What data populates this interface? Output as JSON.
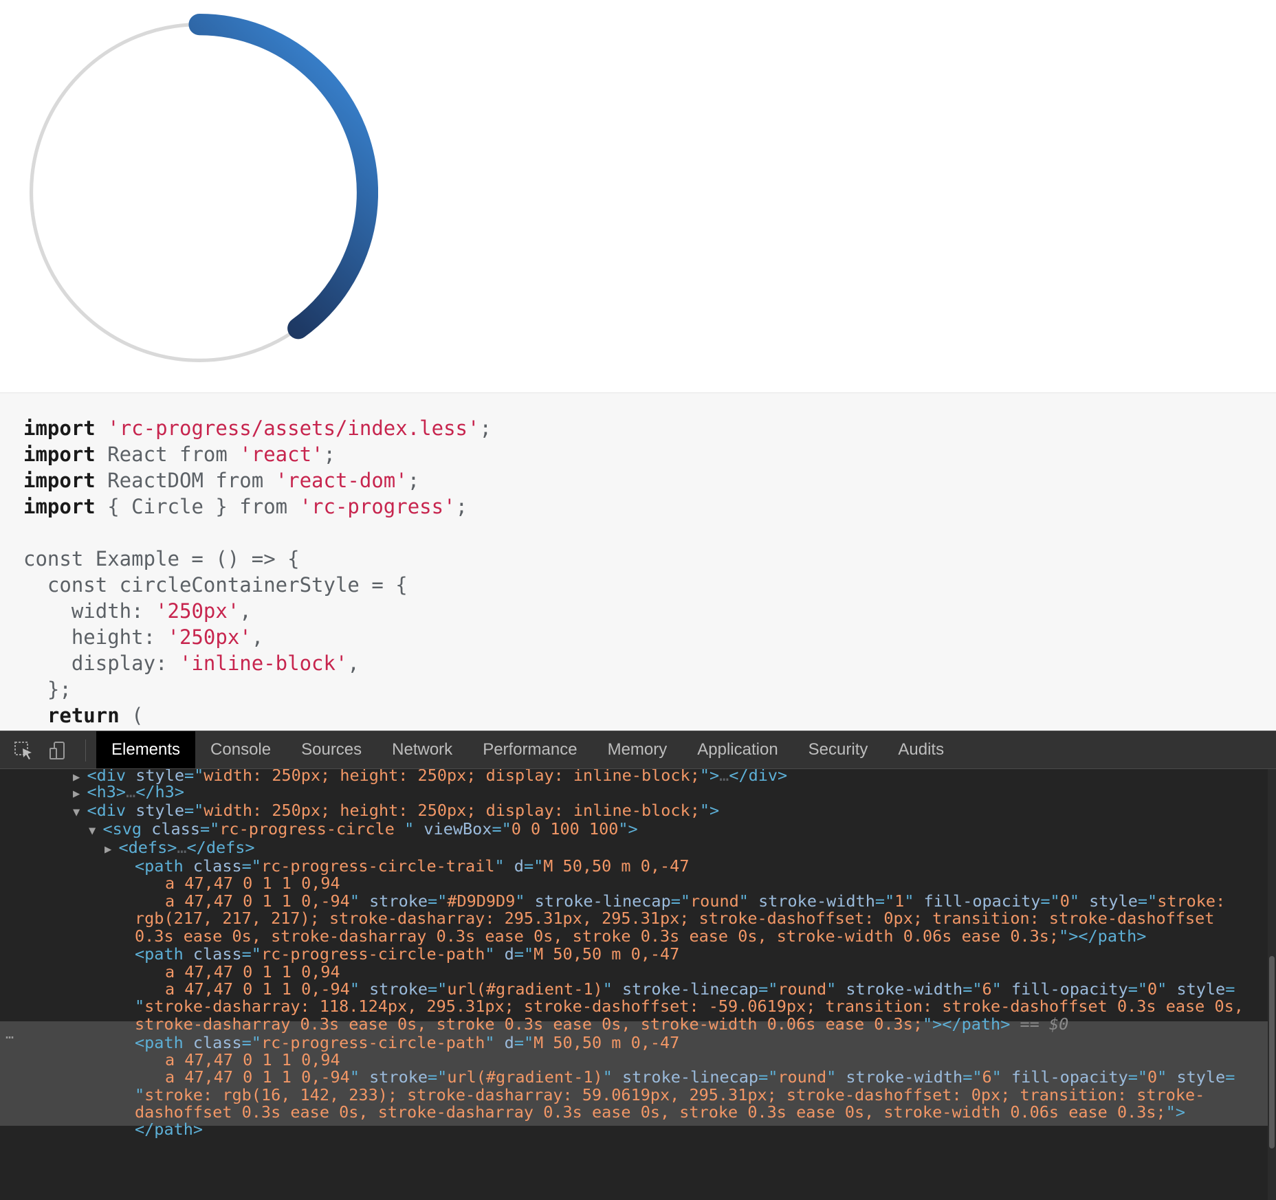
{
  "progress": {
    "percent": 20,
    "offset_percent": 20,
    "stroke_width": 6,
    "trail_width": 1,
    "trail_color": "#D9D9D9",
    "gradient_start": "#1a1a1a",
    "gradient_mid": "#1e3a66",
    "gradient_end": "#3e91e4"
  },
  "code": {
    "lines": [
      [
        [
          "kw",
          "import"
        ],
        [
          "txt",
          " "
        ],
        [
          "str",
          "'rc-progress/assets/index.less'"
        ],
        [
          "txt",
          ";"
        ]
      ],
      [
        [
          "kw",
          "import"
        ],
        [
          "txt",
          " React from "
        ],
        [
          "str",
          "'react'"
        ],
        [
          "txt",
          ";"
        ]
      ],
      [
        [
          "kw",
          "import"
        ],
        [
          "txt",
          " ReactDOM from "
        ],
        [
          "str",
          "'react-dom'"
        ],
        [
          "txt",
          ";"
        ]
      ],
      [
        [
          "kw",
          "import"
        ],
        [
          "txt",
          " { Circle } from "
        ],
        [
          "str",
          "'rc-progress'"
        ],
        [
          "txt",
          ";"
        ]
      ],
      [],
      [
        [
          "txt",
          "const Example = () => {"
        ]
      ],
      [
        [
          "txt",
          "  const circleContainerStyle = {"
        ]
      ],
      [
        [
          "txt",
          "    width: "
        ],
        [
          "str",
          "'250px'"
        ],
        [
          "txt",
          ","
        ]
      ],
      [
        [
          "txt",
          "    height: "
        ],
        [
          "str",
          "'250px'"
        ],
        [
          "txt",
          ","
        ]
      ],
      [
        [
          "txt",
          "    display: "
        ],
        [
          "str",
          "'inline-block'"
        ],
        [
          "txt",
          ","
        ]
      ],
      [
        [
          "txt",
          "  };"
        ]
      ],
      [
        [
          "txt",
          "  "
        ],
        [
          "kw",
          "return"
        ],
        [
          "txt",
          " ("
        ]
      ]
    ]
  },
  "devtools": {
    "tabs": [
      "Elements",
      "Console",
      "Sources",
      "Network",
      "Performance",
      "Memory",
      "Application",
      "Security",
      "Audits"
    ],
    "active_tab": "Elements",
    "inspect_icon": "cursor-select-icon",
    "device_icon": "device-toggle-icon",
    "selected_marker": "== $0",
    "ellipsis": "…",
    "dom_lines": [
      [
        [
          "tri",
          "▶ "
        ],
        [
          "tag",
          "<div "
        ],
        [
          "attr",
          "style"
        ],
        [
          "tag",
          "=\""
        ],
        [
          "val",
          "width: 250px; height: 250px; display: inline-block;"
        ],
        [
          "tag",
          "\">"
        ],
        [
          "txt",
          "…"
        ],
        [
          "tag",
          "</div>"
        ]
      ],
      [
        [
          "tri",
          "▶ "
        ],
        [
          "tag",
          "<h3>"
        ],
        [
          "txt",
          "…"
        ],
        [
          "tag",
          "</h3>"
        ]
      ],
      [
        [
          "tri",
          "▼ "
        ],
        [
          "tag",
          "<div "
        ],
        [
          "attr",
          "style"
        ],
        [
          "tag",
          "=\""
        ],
        [
          "val",
          "width: 250px; height: 250px; display: inline-block;"
        ],
        [
          "tag",
          "\">"
        ]
      ],
      [
        [
          "tri",
          "▼ "
        ],
        [
          "tag",
          "<svg "
        ],
        [
          "attr",
          "class"
        ],
        [
          "tag",
          "=\""
        ],
        [
          "val",
          "rc-progress-circle "
        ],
        [
          "tag",
          "\" "
        ],
        [
          "attr",
          "viewBox"
        ],
        [
          "tag",
          "=\""
        ],
        [
          "val",
          "0 0 100 100"
        ],
        [
          "tag",
          "\">"
        ]
      ],
      [
        [
          "tri",
          "▶ "
        ],
        [
          "tag",
          "<defs>"
        ],
        [
          "txt",
          "…"
        ],
        [
          "tag",
          "</defs>"
        ]
      ],
      [
        [
          "tag",
          "<path "
        ],
        [
          "attr",
          "class"
        ],
        [
          "tag",
          "=\""
        ],
        [
          "val",
          "rc-progress-circle-trail"
        ],
        [
          "tag",
          "\" "
        ],
        [
          "attr",
          "d"
        ],
        [
          "tag",
          "=\""
        ],
        [
          "val",
          "M 50,50 m 0,-47"
        ]
      ],
      [
        [
          "val",
          "a 47,47 0 1 1 0,94"
        ]
      ],
      [
        [
          "val",
          "a 47,47 0 1 1 0,-94"
        ],
        [
          "tag",
          "\" "
        ],
        [
          "attr",
          "stroke"
        ],
        [
          "tag",
          "=\""
        ],
        [
          "val",
          "#D9D9D9"
        ],
        [
          "tag",
          "\" "
        ],
        [
          "attr",
          "stroke-linecap"
        ],
        [
          "tag",
          "=\""
        ],
        [
          "val",
          "round"
        ],
        [
          "tag",
          "\" "
        ],
        [
          "attr",
          "stroke-width"
        ],
        [
          "tag",
          "=\""
        ],
        [
          "val",
          "1"
        ],
        [
          "tag",
          "\" "
        ],
        [
          "attr",
          "fill-opacity"
        ],
        [
          "tag",
          "=\""
        ],
        [
          "val",
          "0"
        ],
        [
          "tag",
          "\" "
        ],
        [
          "attr",
          "style"
        ],
        [
          "tag",
          "=\""
        ],
        [
          "val",
          "stroke:"
        ]
      ],
      [
        [
          "val",
          "rgb(217, 217, 217); stroke-dasharray: 295.31px, 295.31px; stroke-dashoffset: 0px; transition: stroke-dashoffset"
        ]
      ],
      [
        [
          "val",
          "0.3s ease 0s, stroke-dasharray 0.3s ease 0s, stroke 0.3s ease 0s, stroke-width 0.06s ease 0.3s;"
        ],
        [
          "tag",
          "\"></path>"
        ]
      ],
      [
        [
          "tag",
          "<path "
        ],
        [
          "attr",
          "class"
        ],
        [
          "tag",
          "=\""
        ],
        [
          "val",
          "rc-progress-circle-path"
        ],
        [
          "tag",
          "\" "
        ],
        [
          "attr",
          "d"
        ],
        [
          "tag",
          "=\""
        ],
        [
          "val",
          "M 50,50 m 0,-47"
        ]
      ],
      [
        [
          "val",
          "a 47,47 0 1 1 0,94"
        ]
      ],
      [
        [
          "val",
          "a 47,47 0 1 1 0,-94"
        ],
        [
          "tag",
          "\" "
        ],
        [
          "attr",
          "stroke"
        ],
        [
          "tag",
          "=\""
        ],
        [
          "val",
          "url(#gradient-1)"
        ],
        [
          "tag",
          "\" "
        ],
        [
          "attr",
          "stroke-linecap"
        ],
        [
          "tag",
          "=\""
        ],
        [
          "val",
          "round"
        ],
        [
          "tag",
          "\" "
        ],
        [
          "attr",
          "stroke-width"
        ],
        [
          "tag",
          "=\""
        ],
        [
          "val",
          "6"
        ],
        [
          "tag",
          "\" "
        ],
        [
          "attr",
          "fill-opacity"
        ],
        [
          "tag",
          "=\""
        ],
        [
          "val",
          "0"
        ],
        [
          "tag",
          "\" "
        ],
        [
          "attr",
          "style"
        ],
        [
          "tag",
          "="
        ]
      ],
      [
        [
          "tag",
          "\""
        ],
        [
          "val",
          "stroke-dasharray: 118.124px, 295.31px; stroke-dashoffset: -59.0619px; transition: stroke-dashoffset 0.3s ease 0s,"
        ]
      ],
      [
        [
          "val",
          "stroke-dasharray 0.3s ease 0s, stroke 0.3s ease 0s, stroke-width 0.06s ease 0.3s;"
        ],
        [
          "tag",
          "\"></path>"
        ],
        [
          "eq0",
          " == $0"
        ]
      ],
      [
        [
          "tag",
          "<path "
        ],
        [
          "attr",
          "class"
        ],
        [
          "tag",
          "=\""
        ],
        [
          "val",
          "rc-progress-circle-path"
        ],
        [
          "tag",
          "\" "
        ],
        [
          "attr",
          "d"
        ],
        [
          "tag",
          "=\""
        ],
        [
          "val",
          "M 50,50 m 0,-47"
        ]
      ],
      [
        [
          "val",
          "a 47,47 0 1 1 0,94"
        ]
      ],
      [
        [
          "val",
          "a 47,47 0 1 1 0,-94"
        ],
        [
          "tag",
          "\" "
        ],
        [
          "attr",
          "stroke"
        ],
        [
          "tag",
          "=\""
        ],
        [
          "val",
          "url(#gradient-1)"
        ],
        [
          "tag",
          "\" "
        ],
        [
          "attr",
          "stroke-linecap"
        ],
        [
          "tag",
          "=\""
        ],
        [
          "val",
          "round"
        ],
        [
          "tag",
          "\" "
        ],
        [
          "attr",
          "stroke-width"
        ],
        [
          "tag",
          "=\""
        ],
        [
          "val",
          "6"
        ],
        [
          "tag",
          "\" "
        ],
        [
          "attr",
          "fill-opacity"
        ],
        [
          "tag",
          "=\""
        ],
        [
          "val",
          "0"
        ],
        [
          "tag",
          "\" "
        ],
        [
          "attr",
          "style"
        ],
        [
          "tag",
          "="
        ]
      ],
      [
        [
          "tag",
          "\""
        ],
        [
          "val",
          "stroke: rgb(16, 142, 233); stroke-dasharray: 59.0619px, 295.31px; stroke-dashoffset: 0px; transition: stroke-"
        ]
      ],
      [
        [
          "val",
          "dashoffset 0.3s ease 0s, stroke-dasharray 0.3s ease 0s, stroke 0.3s ease 0s, stroke-width 0.06s ease 0.3s;"
        ],
        [
          "tag",
          "\">"
        ]
      ],
      [
        [
          "tag",
          "</path>"
        ]
      ]
    ]
  }
}
